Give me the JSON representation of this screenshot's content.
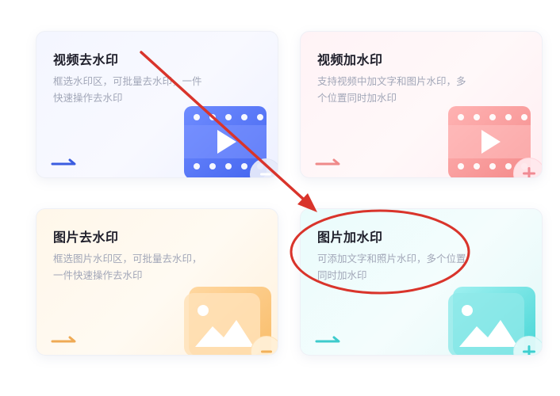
{
  "cards": [
    {
      "title": "视频去水印",
      "desc": "框选水印区，可批量去水印，一件快速操作去水印",
      "accent": "#4a6cf0",
      "badge": "minus-icon"
    },
    {
      "title": "视频加水印",
      "desc": "支持视频中加文字和图片水印，多个位置同时加水印",
      "accent": "#f38b8b",
      "badge": "plus-icon"
    },
    {
      "title": "图片去水印",
      "desc": "框选图片水印区，可批量去水印，一件快速操作去水印",
      "accent": "#f3b05a",
      "badge": "minus-icon"
    },
    {
      "title": "图片加水印",
      "desc": "可添加文字和照片水印，多个位置同时加水印",
      "accent": "#3ecfd0",
      "badge": "plus-icon"
    }
  ],
  "annotation": {
    "color": "#d9342b"
  }
}
